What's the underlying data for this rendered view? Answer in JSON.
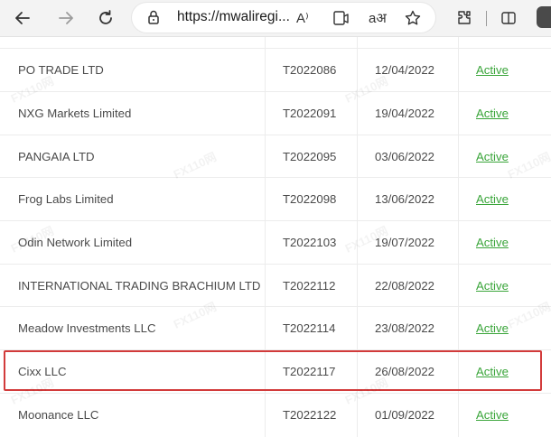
{
  "browser": {
    "url": "https://mwaliregi...",
    "read_aloud_label": "A⁾",
    "translate_label": "aअ"
  },
  "table": {
    "rows": [
      {
        "name": "PO TRADE LTD",
        "code": "T2022086",
        "date": "12/04/2022",
        "status": "Active"
      },
      {
        "name": "NXG Markets Limited",
        "code": "T2022091",
        "date": "19/04/2022",
        "status": "Active"
      },
      {
        "name": "PANGAIA LTD",
        "code": "T2022095",
        "date": "03/06/2022",
        "status": "Active"
      },
      {
        "name": "Frog Labs Limited",
        "code": "T2022098",
        "date": "13/06/2022",
        "status": "Active"
      },
      {
        "name": "Odin Network Limited",
        "code": "T2022103",
        "date": "19/07/2022",
        "status": "Active"
      },
      {
        "name": "INTERNATIONAL TRADING BRACHIUM LTD",
        "code": "T2022112",
        "date": "22/08/2022",
        "status": "Active"
      },
      {
        "name": "Meadow Investments LLC",
        "code": "T2022114",
        "date": "23/08/2022",
        "status": "Active"
      },
      {
        "name": "Cixx LLC",
        "code": "T2022117",
        "date": "26/08/2022",
        "status": "Active"
      },
      {
        "name": "Moonance LLC",
        "code": "T2022122",
        "date": "01/09/2022",
        "status": "Active"
      }
    ]
  },
  "watermark_text": "FX110网",
  "highlighted_row_index": 7,
  "colors": {
    "status_link": "#3aa53a",
    "highlight_border": "#d23b3b"
  }
}
